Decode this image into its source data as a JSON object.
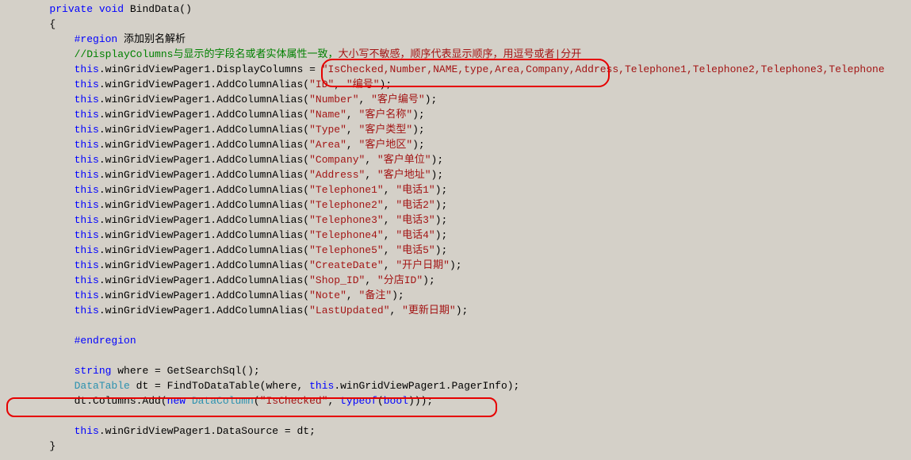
{
  "code": {
    "method_signature_kw1": "private",
    "method_signature_kw2": "void",
    "method_name": " BindData()",
    "open_brace": "{",
    "close_brace": "}",
    "region_kw": "#region",
    "region_label": " 添加别名解析",
    "comment_first": "//DisplayColumns与显示的字段名或者实体属性一致，",
    "comment_second": "大小写不敏感，顺序代表显示顺序，用逗号或者|分开",
    "display_this": "this",
    "display_mid": ".winGridViewPager1.DisplayColumns = ",
    "display_str": "\"IsChecked,Number,NAME,type,Area,Company,Address,Telephone1,Telephone2,Telephone3,Telephone",
    "aliases": [
      {
        "col": "\"ID\"",
        "alias": "\"编号\""
      },
      {
        "col": "\"Number\"",
        "alias": "\"客户编号\""
      },
      {
        "col": "\"Name\"",
        "alias": "\"客户名称\""
      },
      {
        "col": "\"Type\"",
        "alias": "\"客户类型\""
      },
      {
        "col": "\"Area\"",
        "alias": "\"客户地区\""
      },
      {
        "col": "\"Company\"",
        "alias": "\"客户单位\""
      },
      {
        "col": "\"Address\"",
        "alias": "\"客户地址\""
      },
      {
        "col": "\"Telephone1\"",
        "alias": "\"电话1\""
      },
      {
        "col": "\"Telephone2\"",
        "alias": "\"电话2\""
      },
      {
        "col": "\"Telephone3\"",
        "alias": "\"电话3\""
      },
      {
        "col": "\"Telephone4\"",
        "alias": "\"电话4\""
      },
      {
        "col": "\"Telephone5\"",
        "alias": "\"电话5\""
      },
      {
        "col": "\"CreateDate\"",
        "alias": "\"开户日期\""
      },
      {
        "col": "\"Shop_ID\"",
        "alias": "\"分店ID\""
      },
      {
        "col": "\"Note\"",
        "alias": "\"备注\""
      },
      {
        "col": "\"LastUpdated\"",
        "alias": "\"更新日期\""
      }
    ],
    "alias_prefix": ".winGridViewPager1.AddColumnAlias(",
    "alias_sep": ", ",
    "alias_suffix": ");",
    "endregion_kw": "#endregion",
    "where_kw": "string",
    "where_rest": " where = GetSearchSql();",
    "dt_type": "DataTable",
    "dt_rest_a": " dt = FindToDataTable(where, ",
    "dt_rest_b": ".winGridViewPager1.PagerInfo);",
    "addcol_pre": "dt.Columns.Add(",
    "addcol_new": "new",
    "addcol_type": " DataColumn",
    "addcol_open": "(",
    "addcol_str": "\"IsChecked\"",
    "addcol_sep": ", ",
    "addcol_typeof": "typeof",
    "addcol_bool": "bool",
    "addcol_close": ")));",
    "ds_mid": ".winGridViewPager1.DataSource = dt;"
  }
}
